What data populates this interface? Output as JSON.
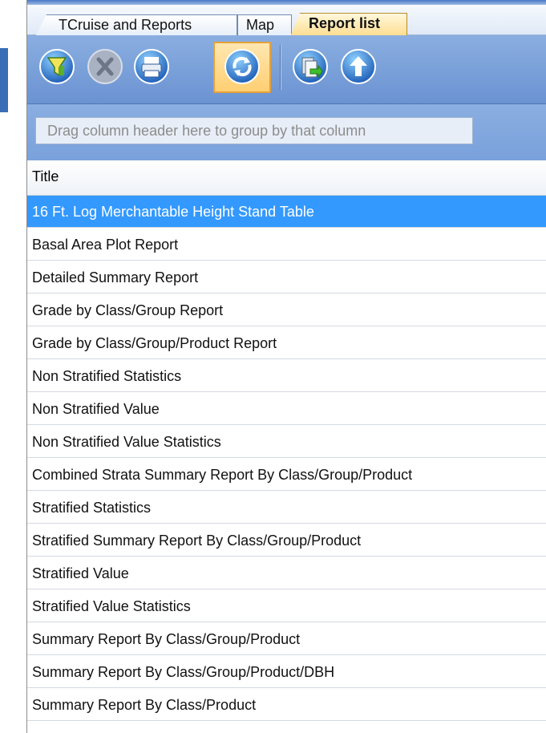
{
  "tabs": [
    {
      "label": "TCruise and Reports",
      "selected": false
    },
    {
      "label": "Map",
      "selected": false
    },
    {
      "label": "Report list",
      "selected": true
    }
  ],
  "toolbar": {
    "buttons": [
      {
        "icon": "filter-icon",
        "enabled": true
      },
      {
        "icon": "clear-filter-icon",
        "enabled": false
      },
      {
        "icon": "print-icon",
        "enabled": true
      },
      {
        "icon": "refresh-icon",
        "enabled": true,
        "pressed": true
      },
      {
        "icon": "export-icon",
        "enabled": true
      },
      {
        "icon": "up-arrow-icon",
        "enabled": true
      }
    ]
  },
  "group_panel": {
    "hint": "Drag column header here to group by that column"
  },
  "grid": {
    "columns": [
      "Title"
    ],
    "selected_index": 0,
    "rows": [
      "16 Ft. Log Merchantable Height Stand Table",
      "Basal Area Plot Report",
      "Detailed Summary Report",
      "Grade by Class/Group Report",
      "Grade by Class/Group/Product Report",
      "Non Stratified Statistics",
      "Non Stratified Value",
      "Non Stratified Value Statistics",
      "Combined Strata Summary Report By Class/Group/Product",
      "Stratified Statistics",
      "Stratified Summary Report By Class/Group/Product",
      "Stratified Value",
      "Stratified Value Statistics",
      "Summary Report By Class/Group/Product",
      "Summary Report By Class/Group/Product/DBH",
      "Summary Report By Class/Product"
    ]
  },
  "colors": {
    "selection": "#3399ff",
    "toolbar": "#7aa1dc",
    "active_tab": "#ffdc8c"
  }
}
